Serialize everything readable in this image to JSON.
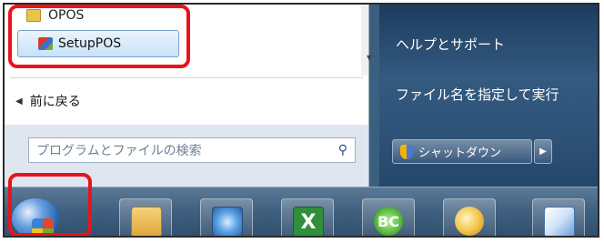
{
  "start_menu": {
    "programs": {
      "folder_label": "OPOS",
      "item_label": "SetupPOS"
    },
    "back_label": "前に戻る",
    "search": {
      "placeholder": "プログラムとファイルの検索"
    },
    "right_panel": {
      "help_label": "ヘルプとサポート",
      "run_label": "ファイル名を指定して実行",
      "shutdown_label": "シャットダウン"
    }
  },
  "taskbar": {
    "excel_glyph": "X",
    "bc_glyph": "BC",
    "apps": [
      "explorer-icon",
      "monitor-icon",
      "excel-icon",
      "bc-icon",
      "paint-icon",
      "control-panel-icon"
    ]
  },
  "colors": {
    "highlight": "#e8141c",
    "panel_blue": "#2f5378"
  }
}
